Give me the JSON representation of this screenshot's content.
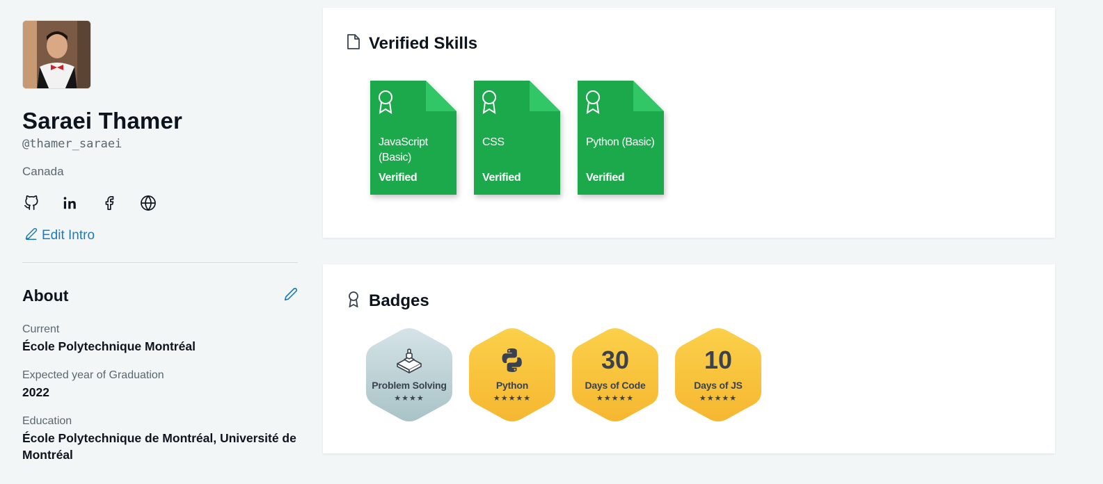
{
  "profile": {
    "name": "Saraei Thamer",
    "handle": "@thamer_saraei",
    "country": "Canada",
    "socials": [
      "github-icon",
      "linkedin-icon",
      "facebook-icon",
      "globe-icon"
    ],
    "edit_intro_label": "Edit Intro"
  },
  "about": {
    "title": "About",
    "fields": [
      {
        "label": "Current",
        "value": "École Polytechnique Montréal"
      },
      {
        "label": "Expected year of Graduation",
        "value": "2022"
      },
      {
        "label": "Education",
        "value": "École Polytechnique de Montréal, Université de Montréal"
      }
    ]
  },
  "skills_card": {
    "title": "Verified Skills",
    "items": [
      {
        "name": "JavaScript (Basic)",
        "status": "Verified"
      },
      {
        "name": "CSS",
        "status": "Verified"
      },
      {
        "name": "Python (Basic)",
        "status": "Verified"
      }
    ]
  },
  "badges_card": {
    "title": "Badges",
    "items": [
      {
        "label": "Problem Solving",
        "number": "",
        "icon": "problem-solving-icon",
        "stars": "★★★★",
        "star_count": 4
      },
      {
        "label": "Python",
        "number": "",
        "icon": "python-icon",
        "stars": "★★★★★",
        "star_count": 5
      },
      {
        "label": "Days of Code",
        "number": "30",
        "icon": "",
        "stars": "★★★★★",
        "star_count": 5
      },
      {
        "label": "Days of JS",
        "number": "10",
        "icon": "",
        "stars": "★★★★★",
        "star_count": 5
      }
    ]
  },
  "colors": {
    "skill_green": "#1ba94c",
    "skill_fold": "#32c766",
    "badge_gold": "#f8c537",
    "badge_silver": "#c4d6dc",
    "link_blue": "#1f7bb6"
  }
}
